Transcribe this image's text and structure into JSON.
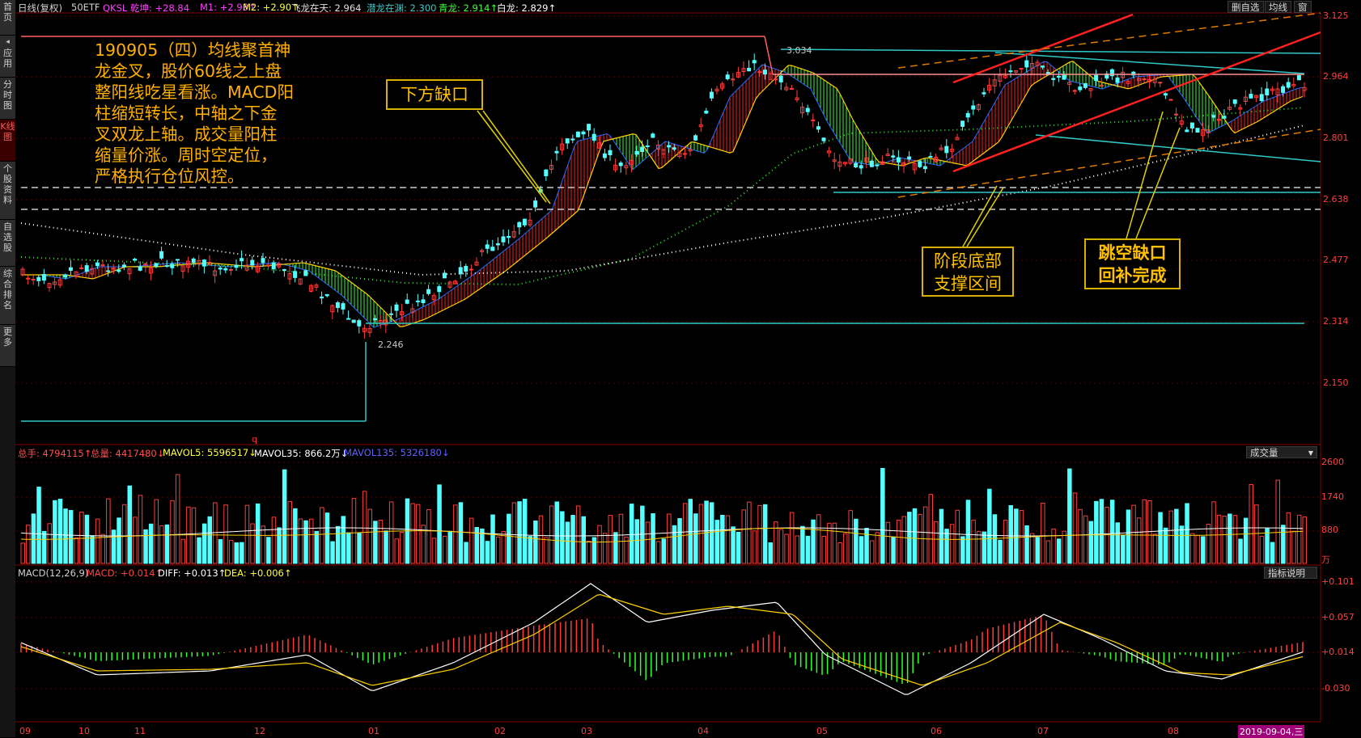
{
  "sidebar": {
    "tabs": [
      {
        "label": "首页"
      },
      {
        "label": "应用"
      },
      {
        "label": "分时图"
      },
      {
        "label": "K线图"
      },
      {
        "label": "个股资料"
      },
      {
        "label": "自选股"
      },
      {
        "label": "综合排名"
      },
      {
        "label": "更多"
      }
    ]
  },
  "header": {
    "period": "日线(复权)",
    "symbol": "50ETF",
    "indicator": "QKSL 乾坤: +28.84",
    "m1": "M1: +2.93↑",
    "m2": "M2: +2.90↑",
    "feilong": "飞龙在天: 2.964",
    "qianlong": "潜龙在渊: 2.300",
    "qinglong": "青龙: 2.914↑",
    "bailong": "白龙: 2.829↑",
    "btn_remove": "删自选",
    "btn_ma": "均线",
    "btn_window": "窗"
  },
  "price_axis": [
    "3.125",
    "2.964",
    "2.801",
    "2.638",
    "2.477",
    "2.314",
    "2.150"
  ],
  "high_label": "3.034",
  "low_label": "2.246",
  "small_mark": "q",
  "volume": {
    "header": {
      "total_hand": "总手: 4794115↑",
      "total_vol": "总量: 4417480↓",
      "mavol5": "MAVOL5: 5596517↓",
      "mavol35": "MAVOL35: 866.2万↓",
      "mavol135": "MAVOL135: 5326180↓"
    },
    "selector": "成交量",
    "axis": [
      "2600",
      "1740",
      "880"
    ],
    "unit": "万"
  },
  "macd": {
    "header": {
      "name": "MACD(12,26,9)",
      "macd": "MACD: +0.014↑",
      "diff": "DIFF: +0.013↑",
      "dea": "DEA: +0.006↑"
    },
    "button": "指标说明",
    "axis": [
      "+0.101",
      "+0.057",
      "+0.014",
      "-0.030"
    ]
  },
  "date_axis": [
    "09",
    "10",
    "11",
    "12",
    "01",
    "02",
    "03",
    "04",
    "05",
    "06",
    "07",
    "08"
  ],
  "cursor_date": "2019-09-04,三",
  "annotations": {
    "note_lines": [
      "190905（四）均线聚首神",
      "龙金叉，股价60线之上盘",
      "整阳线吃星看涨。MACD阳",
      "柱缩短转长，中轴之下金",
      "叉双龙上轴。成交量阳柱",
      "缩量价涨。周时空定位，",
      "严格执行仓位风控。"
    ],
    "gap_below": "下方缺口",
    "support_line1": "阶段底部",
    "support_line2": "支撑区间",
    "gap_fill_line1": "跳空缺口",
    "gap_fill_line2": "回补完成"
  },
  "colors": {
    "up": "#ff3c3c",
    "down": "#54ffff",
    "yellow": "#ffc000",
    "ma_green": "#44ff44"
  }
}
